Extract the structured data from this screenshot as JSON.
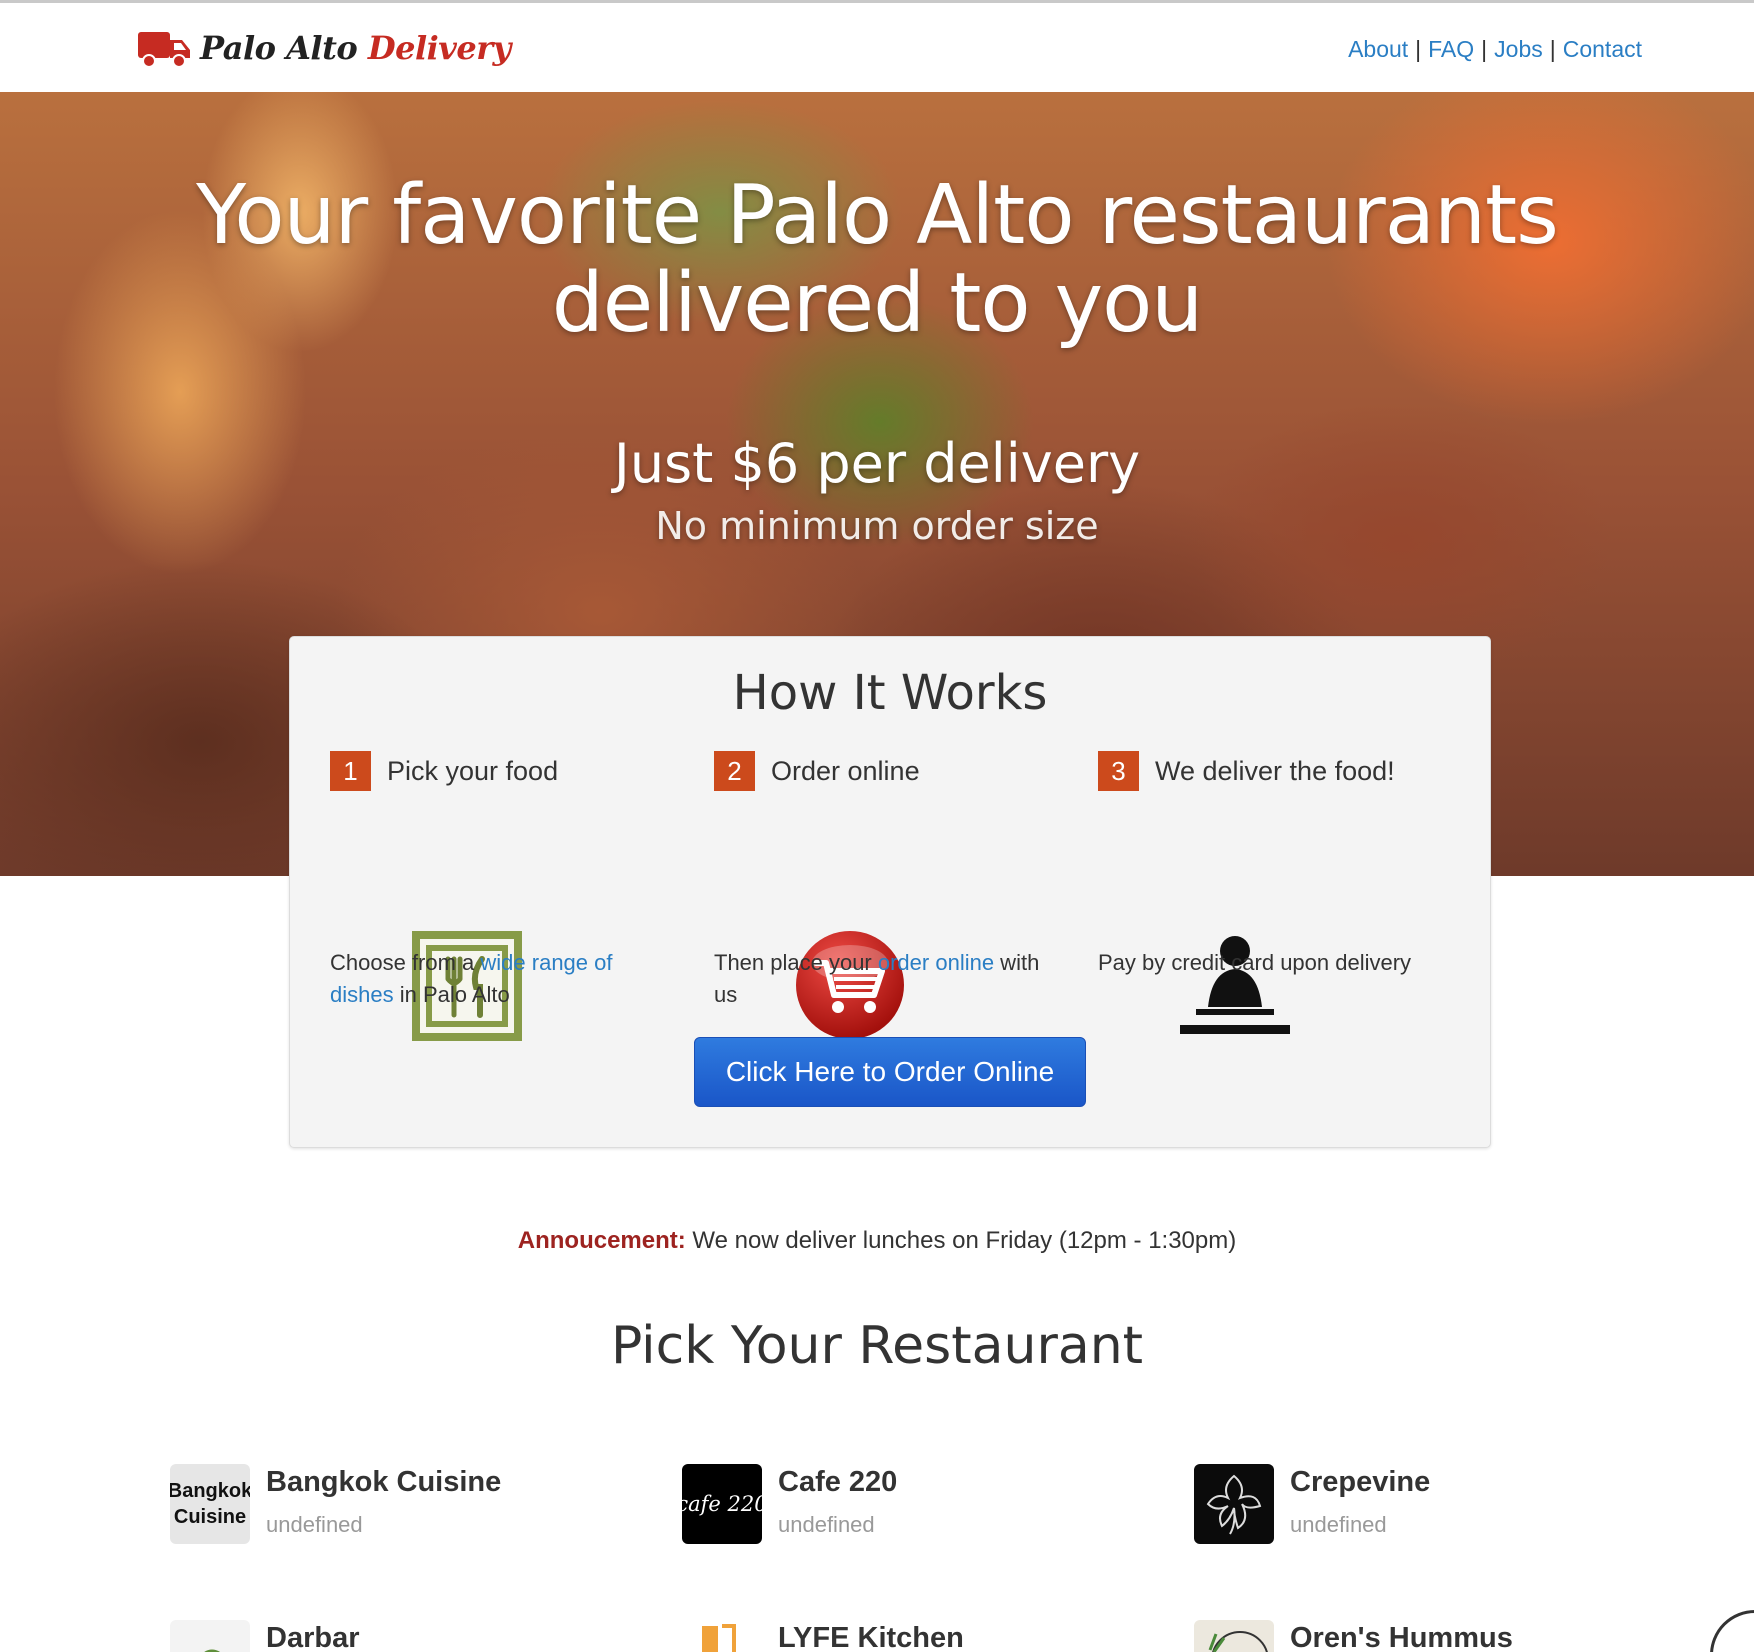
{
  "brand": {
    "name_part1": "Palo Alto",
    "name_part2": "Delivery",
    "truck_color": "#c62b22"
  },
  "nav": {
    "links": [
      "About",
      "FAQ",
      "Jobs",
      "Contact"
    ],
    "separator": "|",
    "link_color": "#2a7ec4"
  },
  "hero": {
    "headline_line1": "Your favorite Palo Alto restaurants",
    "headline_line2": "delivered to you",
    "price": "Just $6 per delivery",
    "minimum": "No minimum order size"
  },
  "how": {
    "title": "How It Works",
    "steps": [
      {
        "number": "1",
        "title": "Pick your food",
        "icon": "utensils-icon",
        "desc_pre": "Choose from a ",
        "desc_link": "wide range of dishes",
        "desc_post": " in Palo Alto"
      },
      {
        "number": "2",
        "title": "Order online",
        "icon": "shopping-cart-icon",
        "desc_pre": "Then place your ",
        "desc_link": "order online",
        "desc_post": " with us"
      },
      {
        "number": "3",
        "title": "We deliver the food!",
        "icon": "cashier-person-icon",
        "desc_pre": "Pay by credit card upon delivery",
        "desc_link": "",
        "desc_post": ""
      }
    ],
    "button": "Click Here to Order Online",
    "badge_color": "#cc4a1c"
  },
  "announcement": {
    "label": "Annoucement:",
    "text": " We now deliver lunches on Friday (12pm - 1:30pm)"
  },
  "restaurants": {
    "title": "Pick Your Restaurant",
    "items": [
      {
        "name": "Bangkok Cuisine",
        "sub": "undefined",
        "logo_text_1": "Bangkok",
        "logo_text_2": "Cuisine"
      },
      {
        "name": "Cafe 220",
        "sub": "undefined",
        "logo_text_1": "cafe 220",
        "logo_text_2": ""
      },
      {
        "name": "Crepevine",
        "sub": "undefined",
        "logo_text_1": "",
        "logo_text_2": ""
      },
      {
        "name": "Darbar",
        "sub": "",
        "logo_text_1": "",
        "logo_text_2": ""
      },
      {
        "name": "LYFE Kitchen",
        "sub": "",
        "logo_text_1": "",
        "logo_text_2": ""
      },
      {
        "name": "Oren's Hummus",
        "sub": "",
        "logo_text_1": "",
        "logo_text_2": ""
      }
    ]
  }
}
